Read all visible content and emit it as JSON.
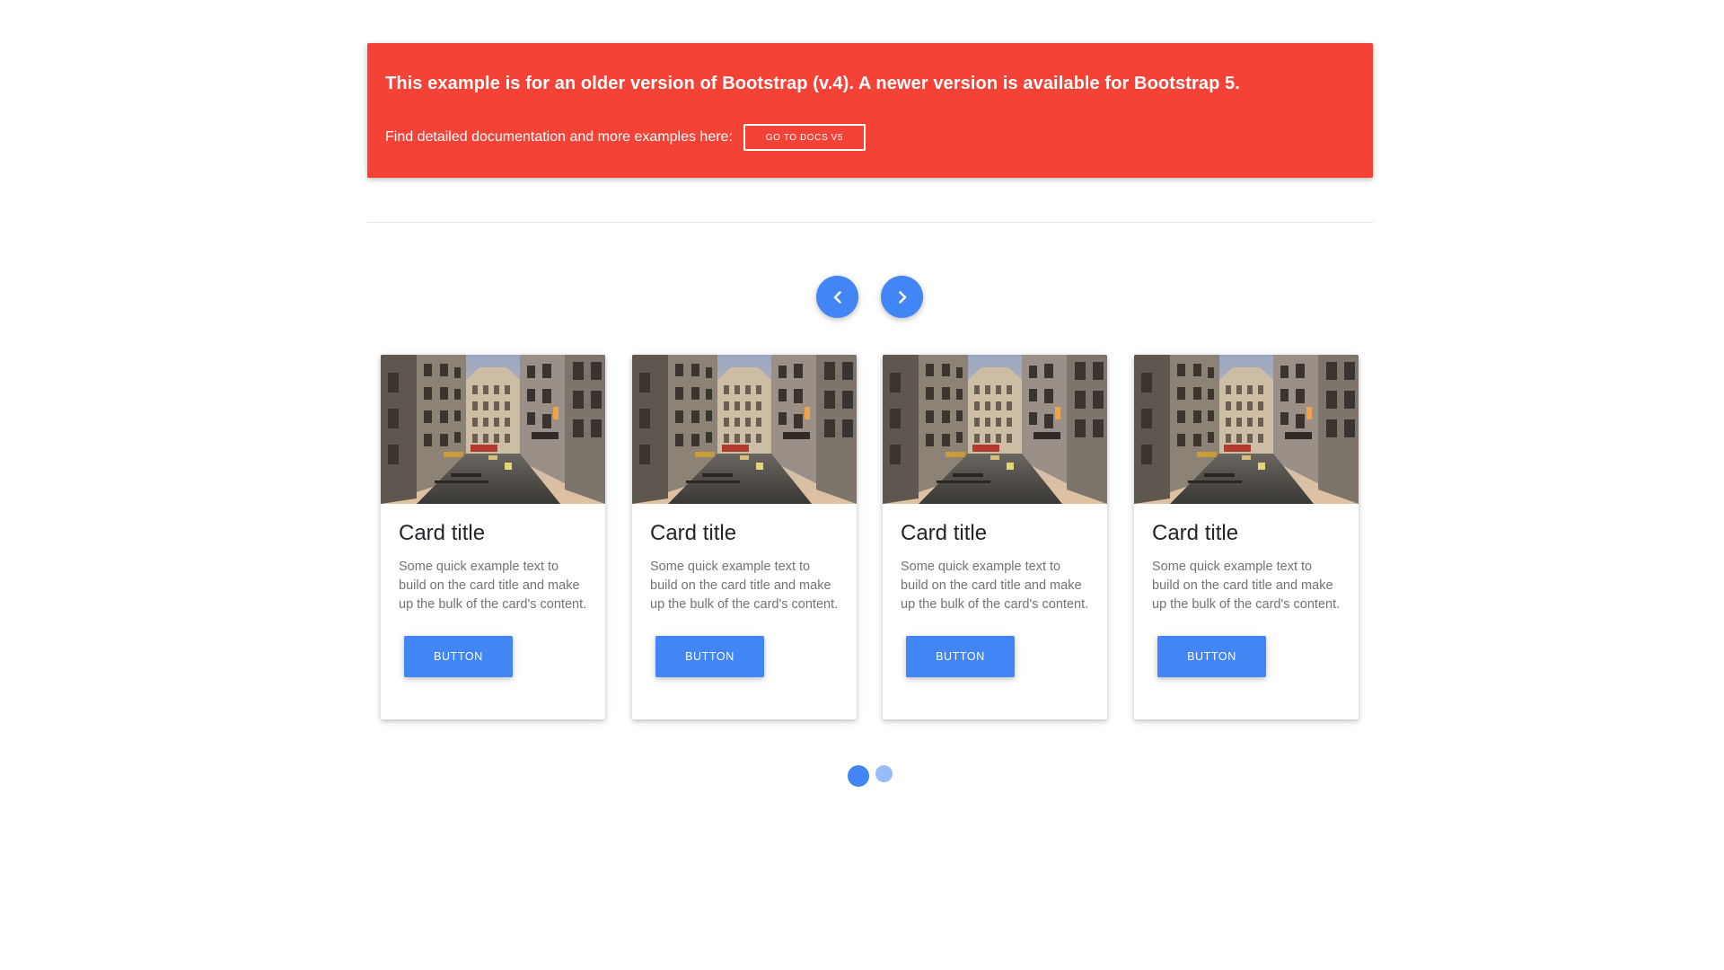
{
  "alert": {
    "title": "This example is for an older version of Bootstrap (v.4). A newer version is available for Bootstrap 5.",
    "text": "Find detailed documentation and more examples here:",
    "button_label": "GO TO DOCS V5",
    "color": "#f44336"
  },
  "carousel": {
    "prev_icon": "chevron-left-icon",
    "next_icon": "chevron-right-icon",
    "accent_color": "#4285f4",
    "cards": [
      {
        "image": "paris-street-photo",
        "title": "Card title",
        "text": "Some quick example text to build on the card title and make up the bulk of the card's content.",
        "button_label": "BUTTON"
      },
      {
        "image": "paris-street-photo",
        "title": "Card title",
        "text": "Some quick example text to build on the card title and make up the bulk of the card's content.",
        "button_label": "BUTTON"
      },
      {
        "image": "paris-street-photo",
        "title": "Card title",
        "text": "Some quick example text to build on the card title and make up the bulk of the card's content.",
        "button_label": "BUTTON"
      },
      {
        "image": "paris-street-photo",
        "title": "Card title",
        "text": "Some quick example text to build on the card title and make up the bulk of the card's content.",
        "button_label": "BUTTON"
      }
    ],
    "indicators": {
      "count": 2,
      "active_index": 0
    }
  }
}
